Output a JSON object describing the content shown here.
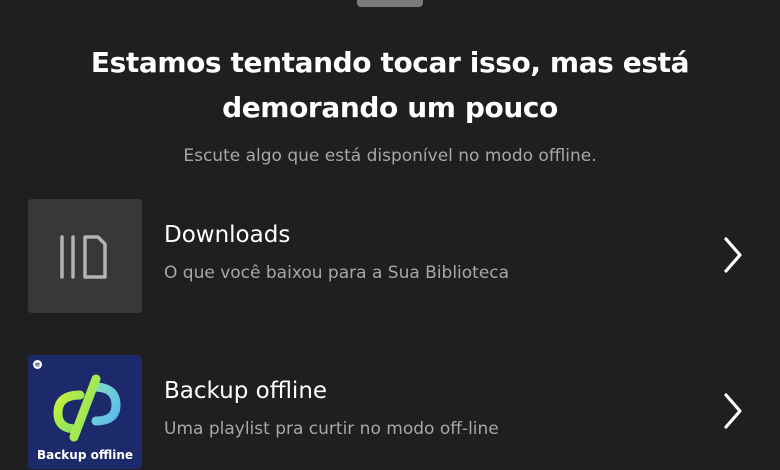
{
  "header": {
    "title": "Estamos tentando tocar isso, mas está demorando um pouco",
    "subtitle": "Escute algo que está disponível no modo offline."
  },
  "options": [
    {
      "title": "Downloads",
      "subtitle": "O que você baixou para a Sua Biblioteca",
      "icon": "downloads-icon"
    },
    {
      "title": "Backup offline",
      "subtitle": "Uma playlist pra curtir no modo off-line",
      "cover_label": "Backup offline",
      "icon": "backup-offline-cover"
    }
  ],
  "colors": {
    "background": "#1f1f1f",
    "text_primary": "#ffffff",
    "text_secondary": "#a7a7a7",
    "downloads_tile": "#383838",
    "backup_cover": "#1c2a6b",
    "accent_green": "#b6f03c",
    "accent_blue": "#5fc0ee"
  }
}
